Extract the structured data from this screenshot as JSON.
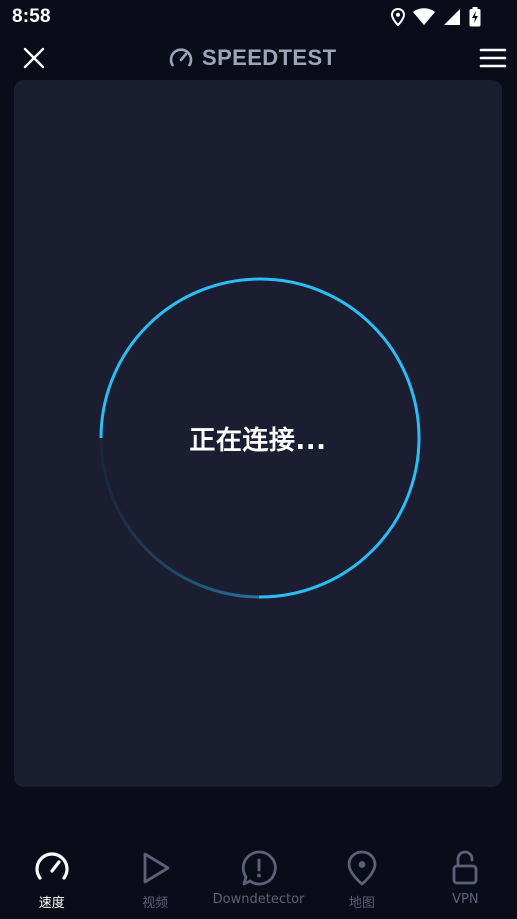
{
  "status_bar": {
    "time": "8:58",
    "icons": [
      "location-icon",
      "wifi-icon",
      "signal-icon",
      "battery-charging-icon"
    ]
  },
  "header": {
    "brand": "SPEEDTEST",
    "close_icon": "close-icon",
    "menu_icon": "hamburger-menu-icon"
  },
  "main": {
    "status_text": "正在连接..."
  },
  "bottom_nav": [
    {
      "label": "速度",
      "icon": "speedometer-icon",
      "active": true
    },
    {
      "label": "视频",
      "icon": "play-icon",
      "active": false
    },
    {
      "label": "Downdetector",
      "icon": "alert-icon",
      "active": false
    },
    {
      "label": "地图",
      "icon": "map-pin-icon",
      "active": false
    },
    {
      "label": "VPN",
      "icon": "lock-icon",
      "active": false
    }
  ],
  "colors": {
    "background": "#0b0c1a",
    "panel": "#1b1d30",
    "accent": "#2bbdf5",
    "brand_text": "#9fa3b8",
    "inactive": "#5d6076"
  }
}
